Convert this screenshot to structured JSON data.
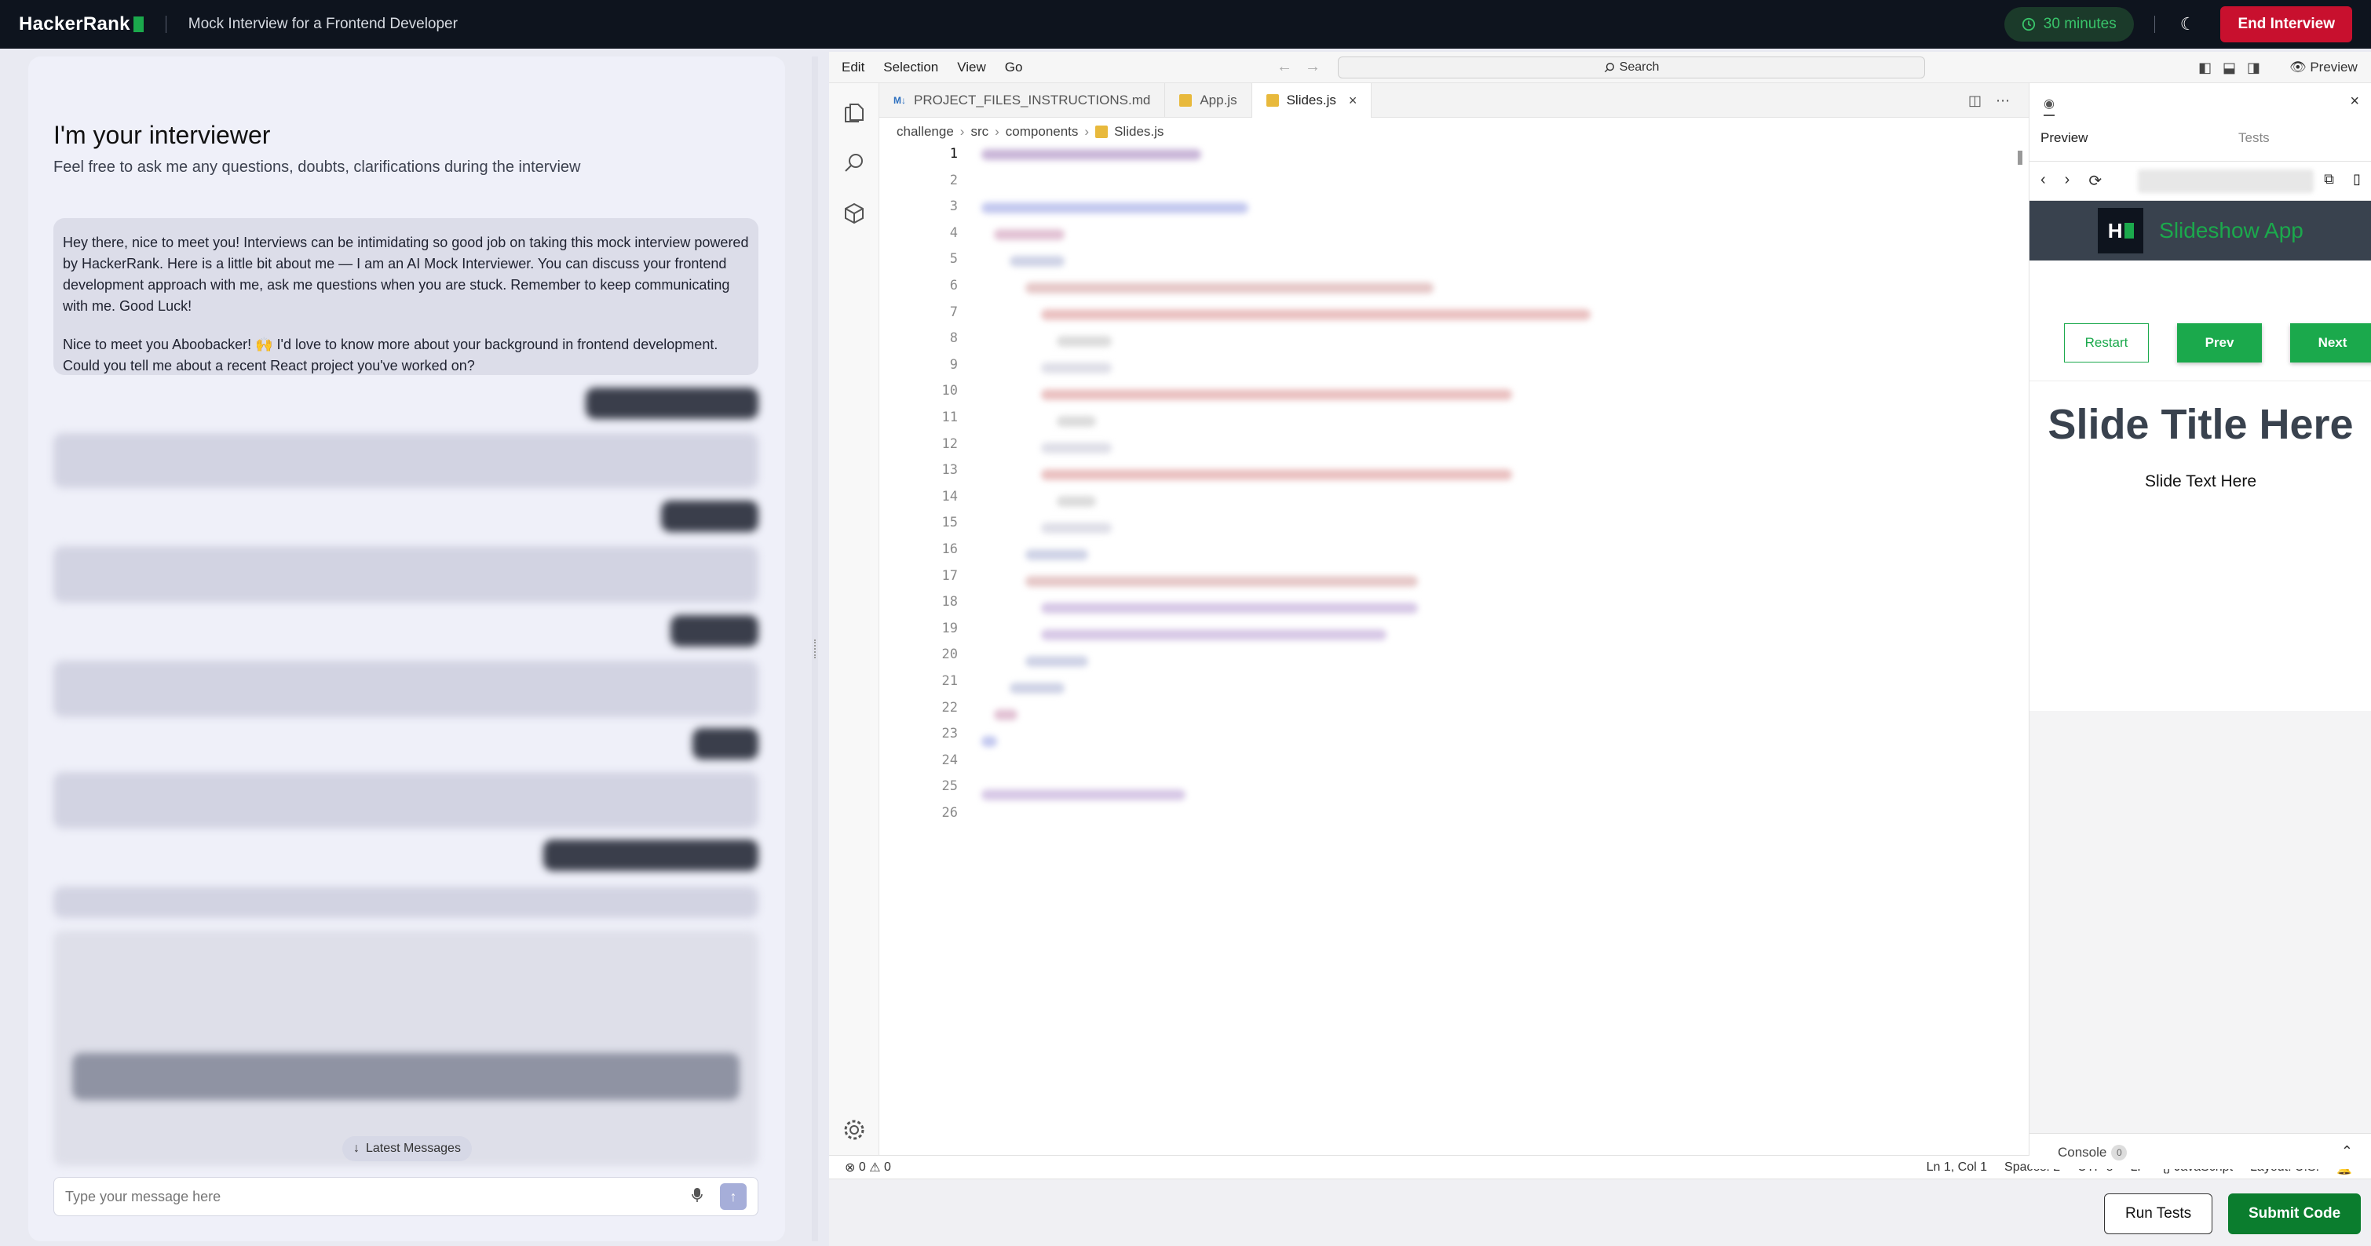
{
  "topbar": {
    "brand": "HackerRank",
    "title": "Mock Interview for a Frontend Developer",
    "timer": "30 minutes",
    "end_label": "End Interview"
  },
  "chat": {
    "title": "I'm your interviewer",
    "subtitle": "Feel free to ask me any questions, doubts, clarifications during the interview",
    "first_message": "Hey there, nice to meet you! Interviews can be intimidating so good job on taking this mock interview powered by HackerRank. Here is a little bit about me — I am an AI Mock Interviewer. You can discuss your frontend development approach with me, ask me questions when you are stuck. Remember to keep communicating with me. Good Luck!",
    "second_message": "Nice to meet you Aboobacker! 🙌 I'd love to know more about your background in frontend development. Could you tell me about a recent React project you've worked on?",
    "latest_label": "Latest Messages",
    "input_placeholder": "Type your message here"
  },
  "menu": {
    "items": [
      "Edit",
      "Selection",
      "View",
      "Go"
    ],
    "search": "Search",
    "preview_toggle": "Preview"
  },
  "tabs": [
    {
      "label": "PROJECT_FILES_INSTRUCTIONS.md",
      "badge": "M↓"
    },
    {
      "label": "App.js"
    },
    {
      "label": "Slides.js"
    }
  ],
  "breadcrumbs": [
    "challenge",
    "src",
    "components",
    "Slides.js"
  ],
  "line_numbers": [
    "1",
    "2",
    "3",
    "4",
    "5",
    "6",
    "7",
    "8",
    "9",
    "10",
    "11",
    "12",
    "13",
    "14",
    "15",
    "16",
    "17",
    "18",
    "19",
    "20",
    "21",
    "22",
    "23",
    "24",
    "25",
    "26"
  ],
  "status": {
    "errors": "0",
    "warnings": "0",
    "position": "Ln 1, Col 1",
    "spaces": "Spaces: 2",
    "encoding": "UTF-8",
    "eol": "LF",
    "language": "JavaScript",
    "layout": "Layout: U.S."
  },
  "actions": {
    "run": "Run Tests",
    "submit": "Submit Code"
  },
  "preview": {
    "tab_preview": "Preview",
    "tab_tests": "Tests",
    "app_title": "Slideshow App",
    "logo_letter": "H",
    "btn_restart": "Restart",
    "btn_prev": "Prev",
    "btn_next": "Next",
    "slide_title": "Slide Title Here",
    "slide_text": "Slide Text Here",
    "console_label": "Console",
    "console_count": "0"
  },
  "colors": {
    "brand_green": "#1ba94c",
    "end_red": "#c8102e",
    "submit_green": "#0b7d2e",
    "topbar": "#0e141e"
  }
}
